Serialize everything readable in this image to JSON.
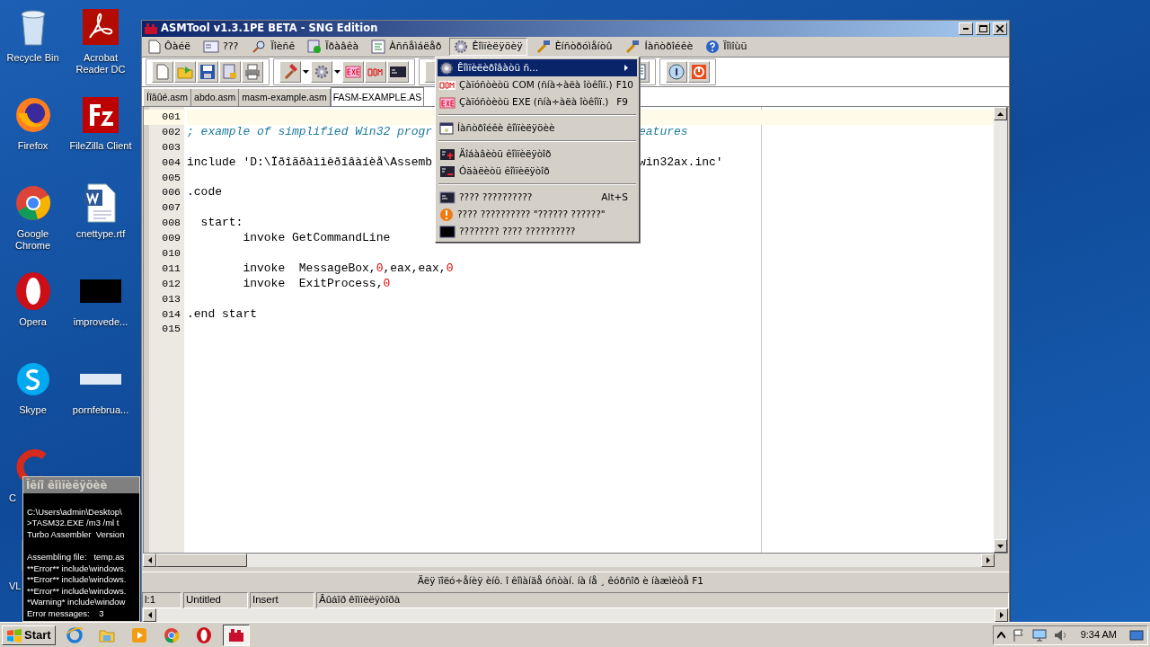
{
  "desktop": {
    "icons": [
      {
        "label": "Recycle Bin",
        "kind": "trash"
      },
      {
        "label": "Firefox",
        "kind": "firefox"
      },
      {
        "label": "Google Chrome",
        "kind": "chrome"
      },
      {
        "label": "Opera",
        "kind": "opera"
      },
      {
        "label": "Skype",
        "kind": "skype"
      },
      {
        "label": "C",
        "kind": "ccleaner"
      },
      {
        "label": "VL",
        "kind": "vlc"
      },
      {
        "label": "Acrobat Reader DC",
        "kind": "pdf"
      },
      {
        "label": "FileZilla Client",
        "kind": "filezilla"
      },
      {
        "label": "cnettype.rtf",
        "kind": "word"
      },
      {
        "label": "improvede...",
        "kind": "black"
      },
      {
        "label": "pornfebrua...",
        "kind": "blank"
      }
    ]
  },
  "window": {
    "title": "ASMTool v1.3.1PE BETA - SNG Edition",
    "menu": [
      {
        "label": "Ôàéë",
        "kind": "page",
        "selected": false
      },
      {
        "label": "???",
        "kind": "form",
        "selected": false
      },
      {
        "label": "Ïîèñê",
        "kind": "search",
        "selected": false
      },
      {
        "label": "Ïðàâêà",
        "kind": "check",
        "selected": false
      },
      {
        "label": "Àññåìáëåð",
        "kind": "list",
        "selected": false
      },
      {
        "label": "Êîìïèëÿöèÿ",
        "kind": "gear",
        "selected": true
      },
      {
        "label": "Èíñòðóìåíòû",
        "kind": "tools",
        "selected": false
      },
      {
        "label": "Íàñòðîéêè",
        "kind": "tools",
        "selected": false
      },
      {
        "label": "Ïîìîùü",
        "kind": "help",
        "selected": false
      }
    ],
    "tabs": [
      {
        "label": "Íîâûé.asm",
        "selected": false
      },
      {
        "label": "abdo.asm",
        "selected": false
      },
      {
        "label": "masm-example.asm",
        "selected": false
      },
      {
        "label": "FASM-EXAMPLE.AS",
        "selected": true
      }
    ],
    "editor": {
      "lines": [
        {
          "number": "001",
          "current": true
        },
        {
          "number": "002",
          "current": false,
          "tokens": [
            {
              "text": "; example of simplified Win32 progr",
              "kind": "comment"
            }
          ],
          "tail": [
            {
              "text": "eatures",
              "kind": "comment"
            }
          ]
        },
        {
          "number": "003",
          "current": false
        },
        {
          "number": "004",
          "current": false,
          "tokens": [
            {
              "text": "include 'D:\\Ïðîãðàììèðîâàíèå\\Assemb",
              "kind": "plain"
            }
          ],
          "tail": [
            {
              "text": "win32ax.inc'",
              "kind": "plain"
            }
          ]
        },
        {
          "number": "005",
          "current": false
        },
        {
          "number": "006",
          "current": false,
          "tokens": [
            {
              "text": ".code",
              "kind": "plain"
            }
          ]
        },
        {
          "number": "007",
          "current": false
        },
        {
          "number": "008",
          "current": false,
          "tokens": [
            {
              "text": "  start:",
              "kind": "plain"
            }
          ]
        },
        {
          "number": "009",
          "current": false,
          "tokens": [
            {
              "text": "        invoke GetCommandLine",
              "kind": "plain"
            }
          ]
        },
        {
          "number": "010",
          "current": false
        },
        {
          "number": "011",
          "current": false,
          "tokens": [
            {
              "text": "        invoke  MessageBox,",
              "kind": "plain"
            },
            {
              "text": "0",
              "kind": "number"
            },
            {
              "text": ",eax,eax,",
              "kind": "plain"
            },
            {
              "text": "0",
              "kind": "number"
            }
          ]
        },
        {
          "number": "012",
          "current": false,
          "tokens": [
            {
              "text": "        invoke  ExitProcess,",
              "kind": "plain"
            },
            {
              "text": "0",
              "kind": "number"
            }
          ]
        },
        {
          "number": "013",
          "current": false
        },
        {
          "number": "014",
          "current": false,
          "tokens": [
            {
              "text": ".end start",
              "kind": "plain"
            }
          ]
        },
        {
          "number": "015",
          "current": false
        }
      ]
    },
    "hint": "Äëÿ ïîëó÷åíèÿ èíô. î êîìàíäå óñòàí. íà íå ¸ êóðñîð è íàæìèòå F1",
    "status_bar": [
      "l:1",
      "Untitled",
      "Insert",
      "Âûáîð êîìïèëÿòîðà"
    ]
  },
  "dropdown": [
    {
      "kind": "item",
      "label": "Êîìïèëèðîâàòü ñ...",
      "submenu": true,
      "selected": true
    },
    {
      "kind": "item",
      "label": "Çàïóñòèòü COM (ñíà÷àëà îòêîìï.)",
      "shortcut": "F10",
      "selected": false
    },
    {
      "kind": "item",
      "label": "Çàïóñòèòü EXE (ñíà÷àëà îòêîìï.)",
      "shortcut": "F9",
      "selected": false
    },
    {
      "kind": "separator"
    },
    {
      "kind": "item",
      "label": "Íàñòðîéêè êîìïèëÿöèè",
      "selected": false
    },
    {
      "kind": "separator"
    },
    {
      "kind": "item",
      "label": "Äîáàâèòü êîìïèëÿòîð",
      "selected": false
    },
    {
      "kind": "item",
      "label": "Óäàëèòü êîìïèëÿòîð",
      "selected": false
    },
    {
      "kind": "separator"
    },
    {
      "kind": "item",
      "label": "???? ??????????",
      "shortcut": "Alt+S",
      "selected": false
    },
    {
      "kind": "item",
      "label": "???? ?????????? \"?????? ??????\"",
      "selected": false
    },
    {
      "kind": "item",
      "label": "???????? ???? ??????????",
      "selected": false
    }
  ],
  "console": {
    "title": "Îêíî êîìïèëÿöèè",
    "blocks": [
      [
        "C:\\Users\\admin\\Desktop\\",
        ">TASM32.EXE /m3 /ml t",
        "Turbo Assembler  Version"
      ],
      [
        "Assembling file:   temp.as",
        "**Error** include\\windows.",
        "**Error** include\\windows.",
        "**Error** include\\windows.",
        "*Warning* include\\window",
        "Error messages:    3"
      ]
    ]
  },
  "taskbar": {
    "start": "Start",
    "buttons": [
      {
        "kind": "ie",
        "selected": false
      },
      {
        "kind": "folder",
        "selected": false
      },
      {
        "kind": "media",
        "selected": false
      },
      {
        "kind": "chrome",
        "selected": false
      },
      {
        "kind": "opera",
        "selected": false
      },
      {
        "kind": "asmtool",
        "selected": true
      }
    ],
    "clock": "9:34 AM"
  }
}
